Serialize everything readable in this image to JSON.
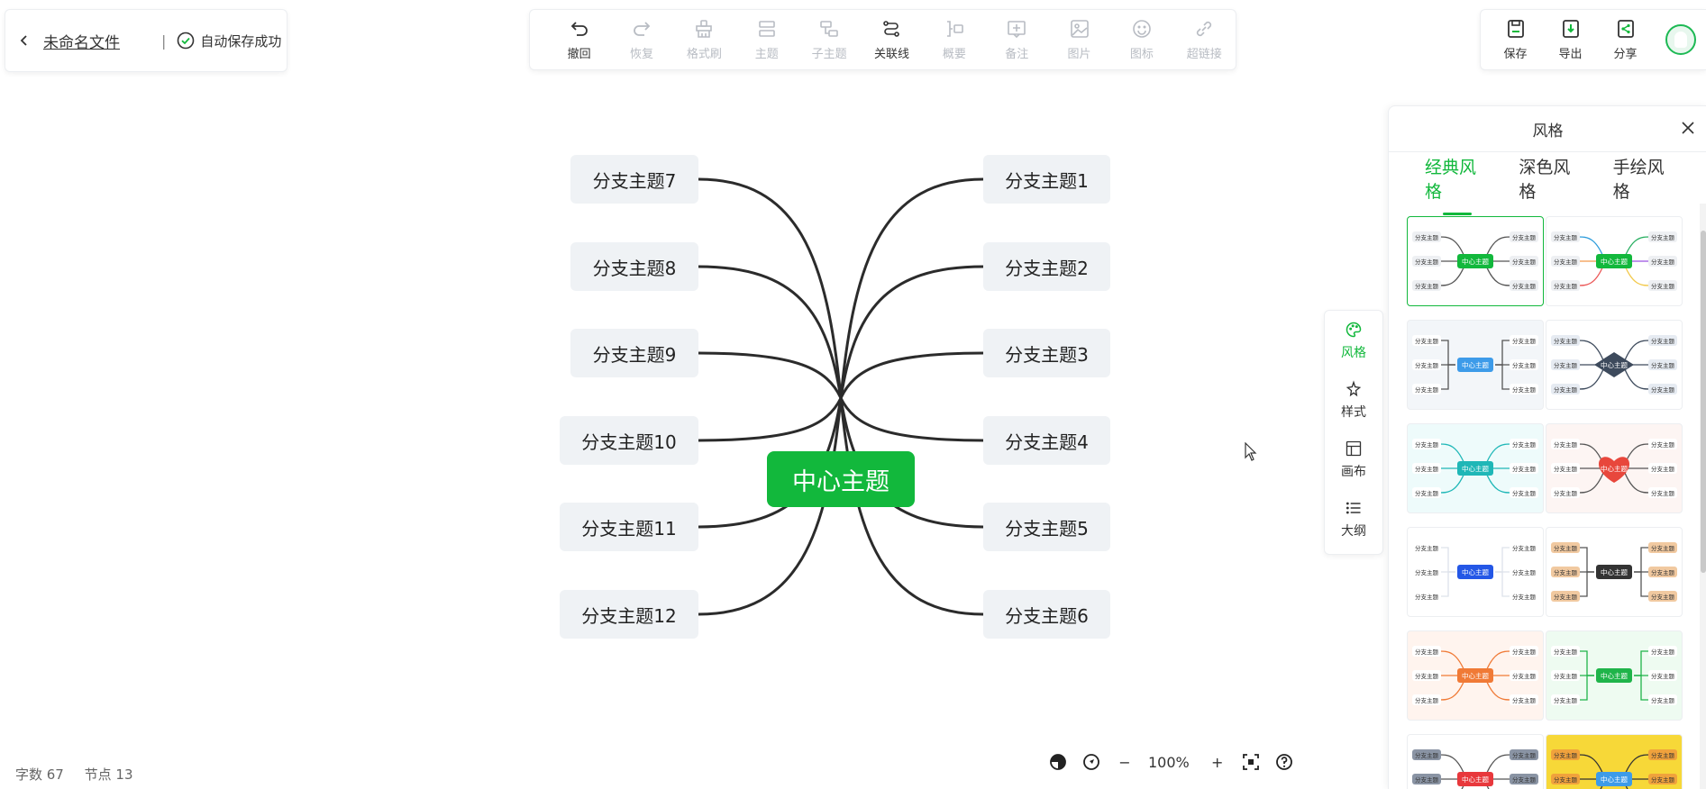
{
  "file": {
    "name": "未命名文件",
    "save_status": "自动保存成功"
  },
  "toolbar": [
    {
      "label": "撤回",
      "icon": "undo-icon",
      "enabled": true
    },
    {
      "label": "恢复",
      "icon": "redo-icon",
      "enabled": false
    },
    {
      "label": "格式刷",
      "icon": "format-brush-icon",
      "enabled": false
    },
    {
      "label": "主题",
      "icon": "topic-icon",
      "enabled": false
    },
    {
      "label": "子主题",
      "icon": "subtopic-icon",
      "enabled": false
    },
    {
      "label": "关联线",
      "icon": "relation-line-icon",
      "enabled": true
    },
    {
      "label": "概要",
      "icon": "summary-icon",
      "enabled": false
    },
    {
      "label": "备注",
      "icon": "note-icon",
      "enabled": false
    },
    {
      "label": "图片",
      "icon": "image-icon",
      "enabled": false
    },
    {
      "label": "图标",
      "icon": "emoji-icon",
      "enabled": false
    },
    {
      "label": "超链接",
      "icon": "link-icon",
      "enabled": false
    }
  ],
  "rightbar": [
    {
      "label": "保存",
      "icon": "save-icon"
    },
    {
      "label": "导出",
      "icon": "export-icon"
    },
    {
      "label": "分享",
      "icon": "share-icon"
    }
  ],
  "mindmap": {
    "center": "中心主题",
    "right_branches": [
      "分支主题1",
      "分支主题2",
      "分支主题3",
      "分支主题4",
      "分支主题5",
      "分支主题6"
    ],
    "left_branches": [
      "分支主题7",
      "分支主题8",
      "分支主题9",
      "分支主题10",
      "分支主题11",
      "分支主题12"
    ]
  },
  "sidenav": [
    {
      "label": "风格",
      "icon": "palette-icon",
      "active": true
    },
    {
      "label": "样式",
      "icon": "style-icon",
      "active": false
    },
    {
      "label": "画布",
      "icon": "canvas-icon",
      "active": false
    },
    {
      "label": "大纲",
      "icon": "outline-icon",
      "active": false
    }
  ],
  "style_panel": {
    "title": "风格",
    "tabs": [
      "经典风格",
      "深色风格",
      "手绘风格"
    ],
    "active_tab": 0,
    "thumb_center_label": "中心主题",
    "thumb_branch_label": "分支主题",
    "thumbnails": [
      {
        "bg": "#ffffff",
        "center": "#12b83c",
        "line": "#555555",
        "branch_bg": "#eef0f3",
        "shape": "curve",
        "selected": true
      },
      {
        "bg": "#ffffff",
        "center": "#12b83c",
        "line": "multicolor",
        "branch_bg": "#eef0f3",
        "shape": "curve",
        "selected": false
      },
      {
        "bg": "#f3f6f9",
        "center": "#3d9be9",
        "line": "#555555",
        "branch_bg": "#ffffff",
        "shape": "bracket",
        "selected": false
      },
      {
        "bg": "#ffffff",
        "center": "#3d4a5c",
        "line": "#3d4a5c",
        "branch_bg": "#e6ebf2",
        "shape": "diamond",
        "selected": false
      },
      {
        "bg": "#eefbfb",
        "center": "#1fb7b7",
        "line": "#1fb7b7",
        "branch_bg": "#ffffff",
        "shape": "curve",
        "selected": false
      },
      {
        "bg": "#fdf5f3",
        "center": "#e8473c",
        "line": "#555555",
        "branch_bg": "#ffffff",
        "shape": "heart",
        "selected": false
      },
      {
        "bg": "#ffffff",
        "center": "#2457e6",
        "line": "#dde2ea",
        "branch_bg": "#ffffff",
        "shape": "bracket",
        "selected": false
      },
      {
        "bg": "#ffffff",
        "center": "#333333",
        "line": "#555555",
        "branch_bg": "#f1c9a0",
        "shape": "bracket",
        "selected": false
      },
      {
        "bg": "#fff4ee",
        "center": "#f07a36",
        "line": "#f07a36",
        "branch_bg": "#ffffff",
        "shape": "curve",
        "selected": false
      },
      {
        "bg": "#eefbf1",
        "center": "#1fb44a",
        "line": "#1fb44a",
        "branch_bg": "#ffffff",
        "shape": "bracket",
        "selected": false
      },
      {
        "bg": "#ffffff",
        "center": "#e8383c",
        "line": "#555555",
        "branch_bg": "#8a94a4",
        "shape": "curve",
        "selected": false
      },
      {
        "bg": "#f7d838",
        "center": "#3d9be9",
        "line": "#333333",
        "branch_bg": "#f0a23c",
        "shape": "curve",
        "selected": false
      }
    ]
  },
  "stats": {
    "word_count": "字数 67",
    "node_count": "节点 13"
  },
  "zoom": {
    "level": "100%",
    "minus": "−",
    "plus": "+"
  },
  "colors": {
    "accent": "#12b83c",
    "branch_bg": "#eff2f5",
    "line": "#2b2b2b"
  }
}
